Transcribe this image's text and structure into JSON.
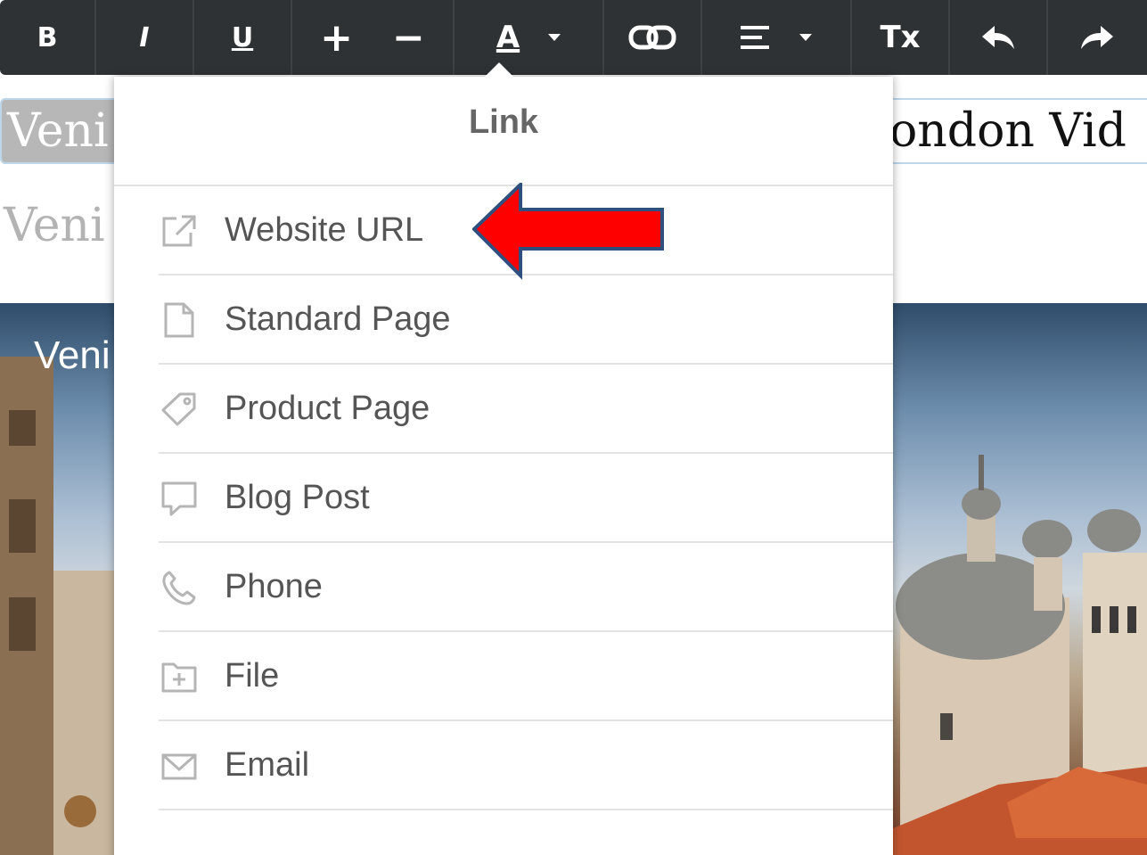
{
  "toolbar": {
    "bold_label": "B",
    "italic_label": "I",
    "underline_label": "U",
    "increase_label": "+",
    "decrease_label": "−",
    "text_color_label": "A",
    "clear_format_label": "Tx",
    "icons": [
      "link-icon",
      "align-icon",
      "undo-icon",
      "redo-icon"
    ]
  },
  "page": {
    "heading_selected_fragment": "Veni",
    "heading_visible_end": "ondon Vid",
    "subheading_fragment": "Veni",
    "hero_caption_fragment": "Veni"
  },
  "link_menu": {
    "title": "Link",
    "items": [
      {
        "label": "Website URL",
        "icon": "external-link-icon"
      },
      {
        "label": "Standard Page",
        "icon": "page-icon"
      },
      {
        "label": "Product Page",
        "icon": "tag-icon"
      },
      {
        "label": "Blog Post",
        "icon": "speech-bubble-icon"
      },
      {
        "label": "Phone",
        "icon": "phone-icon"
      },
      {
        "label": "File",
        "icon": "file-folder-icon"
      },
      {
        "label": "Email",
        "icon": "envelope-icon"
      }
    ]
  },
  "colors": {
    "toolbar_bg": "#2f3235",
    "menu_text": "#555555",
    "menu_icon": "#b5b5b5",
    "annotation_arrow": "#ff0000",
    "annotation_arrow_border": "#2f4f7f"
  }
}
